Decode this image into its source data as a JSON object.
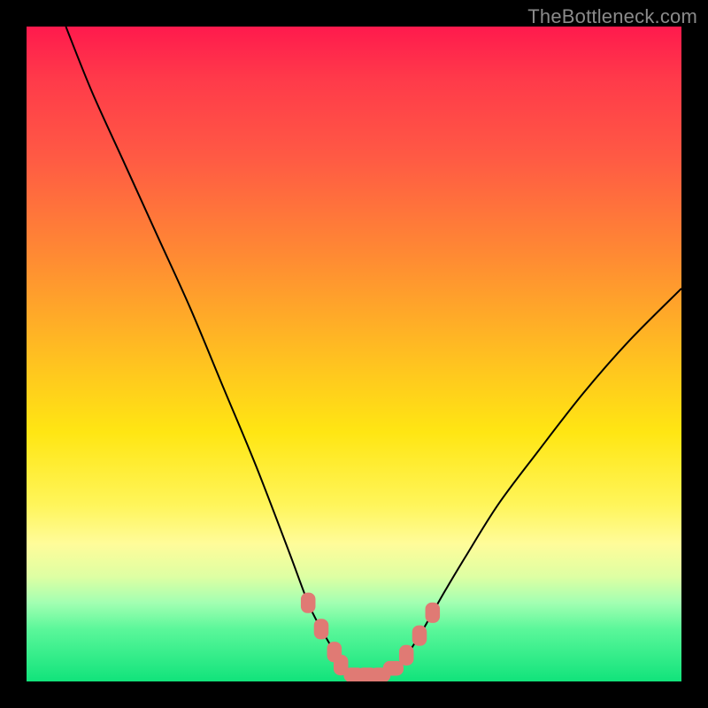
{
  "watermark": "TheBottleneck.com",
  "chart_data": {
    "type": "line",
    "title": "",
    "xlabel": "",
    "ylabel": "",
    "xlim": [
      0,
      100
    ],
    "ylim": [
      0,
      100
    ],
    "series": [
      {
        "name": "curve",
        "x": [
          6,
          10,
          15,
          20,
          25,
          30,
          35,
          40,
          43,
          45,
          47,
          48,
          50,
          52,
          54,
          56,
          58,
          60,
          62,
          64,
          67,
          72,
          78,
          85,
          92,
          100
        ],
        "y": [
          100,
          90,
          79,
          68,
          57,
          45,
          33,
          20,
          12,
          8,
          4.5,
          2.5,
          1,
          1,
          1,
          2,
          4,
          7,
          10.5,
          14,
          19,
          27,
          35,
          44,
          52,
          60
        ]
      }
    ],
    "markers": {
      "name": "highlight-points",
      "color": "#e07a74",
      "points": [
        {
          "x": 43,
          "y": 12,
          "w": 2.1,
          "h": 3.0
        },
        {
          "x": 45,
          "y": 8,
          "w": 2.1,
          "h": 3.0
        },
        {
          "x": 47,
          "y": 4.5,
          "w": 2.1,
          "h": 3.0
        },
        {
          "x": 48,
          "y": 2.5,
          "w": 2.1,
          "h": 3.0
        },
        {
          "x": 50,
          "y": 1,
          "w": 3.0,
          "h": 2.1
        },
        {
          "x": 52,
          "y": 1,
          "w": 3.0,
          "h": 2.1
        },
        {
          "x": 54,
          "y": 1,
          "w": 3.0,
          "h": 2.1
        },
        {
          "x": 56,
          "y": 2,
          "w": 3.0,
          "h": 2.1
        },
        {
          "x": 58,
          "y": 4,
          "w": 2.1,
          "h": 3.0
        },
        {
          "x": 60,
          "y": 7,
          "w": 2.1,
          "h": 3.0
        },
        {
          "x": 62,
          "y": 10.5,
          "w": 2.1,
          "h": 3.0
        }
      ]
    },
    "gradient_stops": [
      {
        "pos": 0,
        "color": "#ff1a4d"
      },
      {
        "pos": 20,
        "color": "#ff5a44"
      },
      {
        "pos": 52,
        "color": "#ffc51f"
      },
      {
        "pos": 79,
        "color": "#fffc9a"
      },
      {
        "pos": 100,
        "color": "#11e37b"
      }
    ]
  }
}
